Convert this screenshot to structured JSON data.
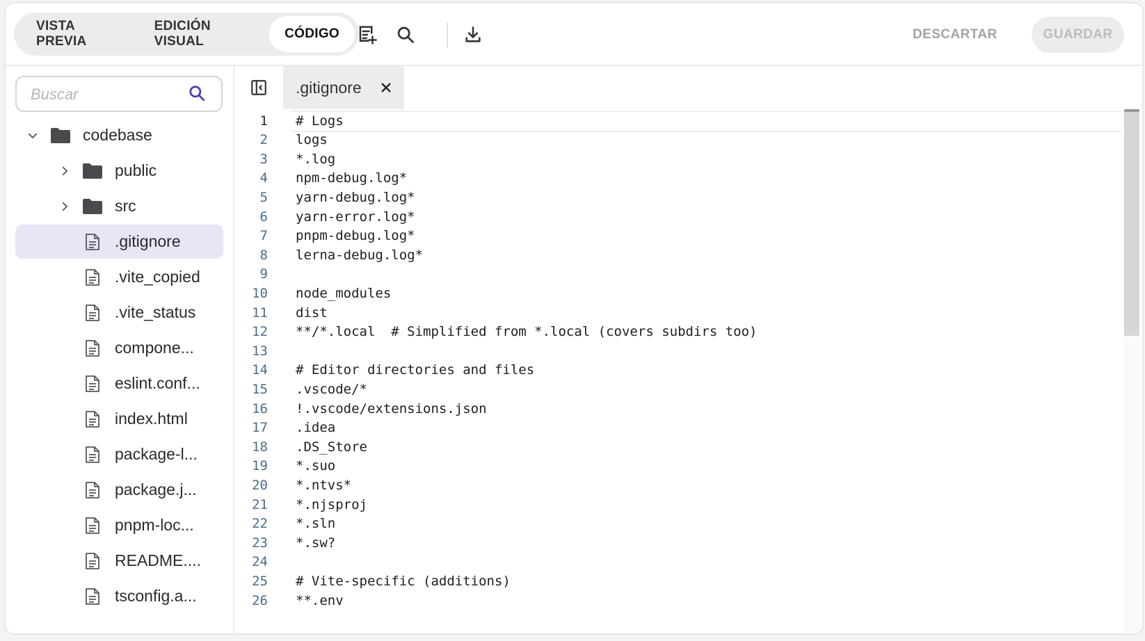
{
  "toolbar": {
    "tabs": [
      {
        "label": "VISTA PREVIA",
        "active": false
      },
      {
        "label": "EDICIÓN VISUAL",
        "active": false
      },
      {
        "label": "CÓDIGO",
        "active": true
      }
    ],
    "icons": [
      "add-note-icon",
      "search-icon",
      "download-icon"
    ],
    "discard_label": "DESCARTAR",
    "save_label": "GUARDAR"
  },
  "sidebar": {
    "search_placeholder": "Buscar",
    "tree": [
      {
        "label": "codebase",
        "type": "folder",
        "level": 0,
        "expanded": true
      },
      {
        "label": "public",
        "type": "folder",
        "level": 1,
        "expanded": false
      },
      {
        "label": "src",
        "type": "folder",
        "level": 1,
        "expanded": false
      },
      {
        "label": ".gitignore",
        "type": "file",
        "level": 1,
        "selected": true
      },
      {
        "label": ".vite_copied",
        "type": "file",
        "level": 1
      },
      {
        "label": ".vite_status",
        "type": "file",
        "level": 1
      },
      {
        "label": "compone...",
        "type": "file",
        "level": 1
      },
      {
        "label": "eslint.conf...",
        "type": "file",
        "level": 1
      },
      {
        "label": "index.html",
        "type": "file",
        "level": 1
      },
      {
        "label": "package-l...",
        "type": "file",
        "level": 1
      },
      {
        "label": "package.j...",
        "type": "file",
        "level": 1
      },
      {
        "label": "pnpm-loc...",
        "type": "file",
        "level": 1
      },
      {
        "label": "README....",
        "type": "file",
        "level": 1
      },
      {
        "label": "tsconfig.a...",
        "type": "file",
        "level": 1
      }
    ]
  },
  "editor": {
    "tab_name": ".gitignore",
    "current_line": 1,
    "lines": [
      "# Logs",
      "logs",
      "*.log",
      "npm-debug.log*",
      "yarn-debug.log*",
      "yarn-error.log*",
      "pnpm-debug.log*",
      "lerna-debug.log*",
      "",
      "node_modules",
      "dist",
      "**/*.local  # Simplified from *.local (covers subdirs too)",
      "",
      "# Editor directories and files",
      ".vscode/*",
      "!.vscode/extensions.json",
      ".idea",
      ".DS_Store",
      "*.suo",
      "*.ntvs*",
      "*.njsproj",
      "*.sln",
      "*.sw?",
      "",
      "# Vite-specific (additions)",
      "**.env"
    ]
  },
  "colors": {
    "selected_bg": "#e8e6f6",
    "search_icon": "#4a3fb0",
    "line_number": "#4a6d8a"
  }
}
